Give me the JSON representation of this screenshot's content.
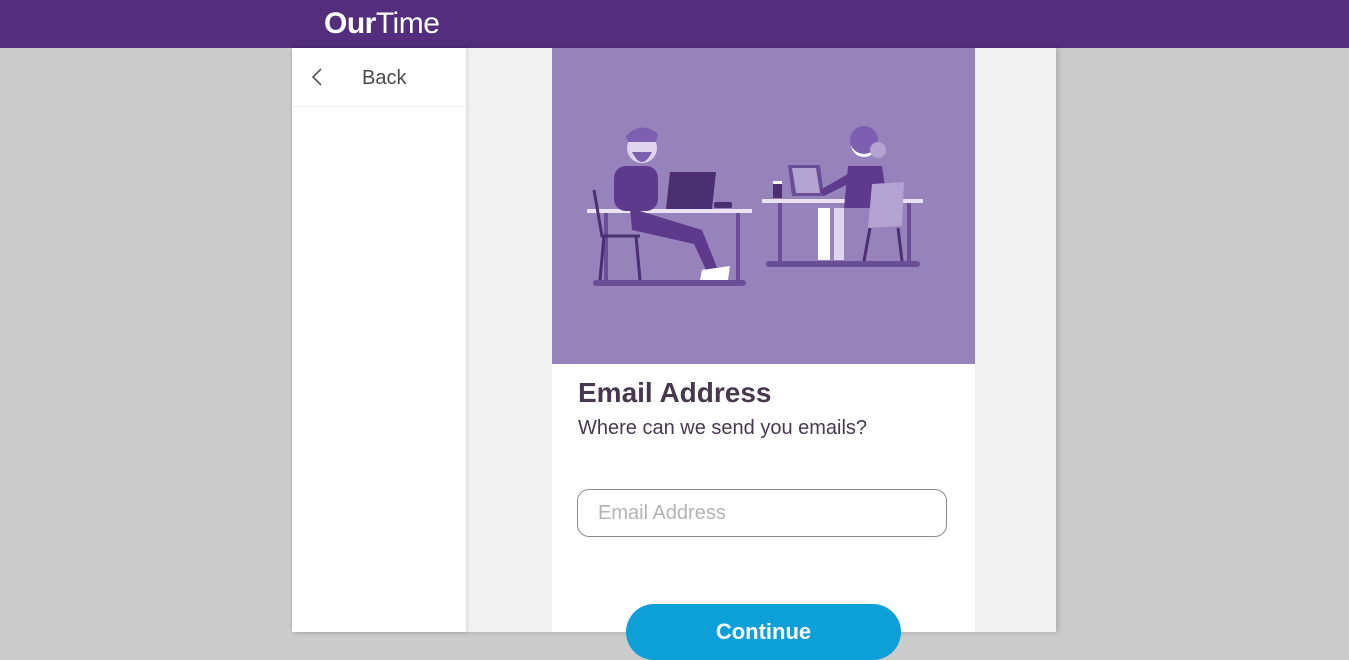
{
  "header": {
    "logo_bold": "Our",
    "logo_light": "Time",
    "color": "#542e7d"
  },
  "sidebar": {
    "back_label": "Back",
    "back_icon": "chevron-left-icon"
  },
  "signup": {
    "title": "Email Address",
    "subtitle": "Where can we send you emails?",
    "email_placeholder": "Email Address",
    "email_value": "",
    "continue_label": "Continue",
    "hero_color": "#9683bb",
    "button_color": "#0d9fd8"
  }
}
